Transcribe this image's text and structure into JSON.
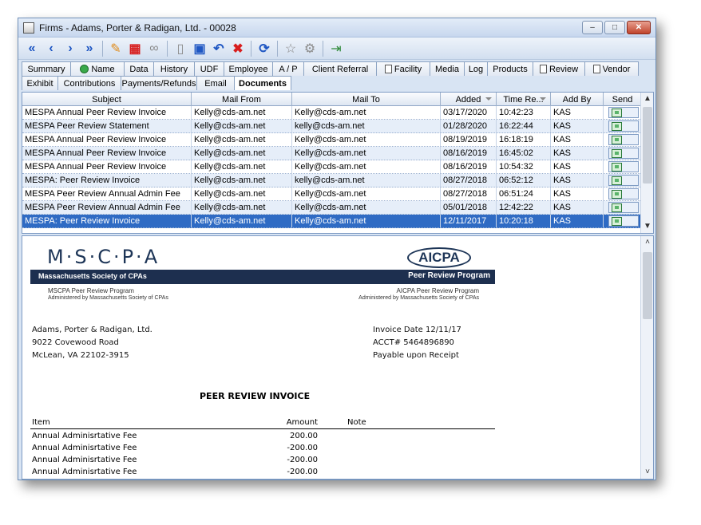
{
  "window": {
    "title": "Firms - Adams, Porter & Radigan, Ltd. - 00028"
  },
  "toolbar": {
    "buttons": [
      {
        "name": "first-record-icon",
        "glyph": "«"
      },
      {
        "name": "previous-record-icon",
        "glyph": "‹"
      },
      {
        "name": "next-record-icon",
        "glyph": "›"
      },
      {
        "name": "last-record-icon",
        "glyph": "»"
      },
      {
        "name": "notes-icon",
        "glyph": "✎"
      },
      {
        "name": "book-icon",
        "glyph": "▦"
      },
      {
        "name": "binoculars-icon",
        "glyph": "∞"
      },
      {
        "name": "new-document-icon",
        "glyph": "▯"
      },
      {
        "name": "save-icon",
        "glyph": "▣"
      },
      {
        "name": "undo-icon",
        "glyph": "↶"
      },
      {
        "name": "delete-icon",
        "glyph": "✖"
      },
      {
        "name": "refresh-icon",
        "glyph": "⟳"
      },
      {
        "name": "favorite-star-icon",
        "glyph": "☆"
      },
      {
        "name": "tools-icon",
        "glyph": "⚙"
      },
      {
        "name": "exit-icon",
        "glyph": "⇥"
      }
    ]
  },
  "tabs_row1": [
    {
      "label": "Summary",
      "icon": ""
    },
    {
      "label": "Name",
      "icon": "green"
    },
    {
      "label": "Data",
      "icon": ""
    },
    {
      "label": "History",
      "icon": ""
    },
    {
      "label": "UDF",
      "icon": ""
    },
    {
      "label": "Employee",
      "icon": ""
    },
    {
      "label": "A / P",
      "icon": ""
    },
    {
      "label": "Client Referral",
      "icon": ""
    },
    {
      "label": "Facility",
      "icon": "doc"
    },
    {
      "label": "Media",
      "icon": ""
    },
    {
      "label": "Log",
      "icon": ""
    },
    {
      "label": "Products",
      "icon": ""
    },
    {
      "label": "Review",
      "icon": "doc"
    },
    {
      "label": "Vendor",
      "icon": "doc"
    }
  ],
  "tabs_row2": [
    {
      "label": "Exhibit"
    },
    {
      "label": "Contributions"
    },
    {
      "label": "Payments/Refunds"
    },
    {
      "label": "Email"
    },
    {
      "label": "Documents"
    }
  ],
  "grid": {
    "columns": [
      "Subject",
      "Mail From",
      "Mail To",
      "Added",
      "Time Re...",
      "Add By",
      "Send"
    ],
    "rows": [
      {
        "subject": "MESPA Annual Peer Review Invoice",
        "from": "Kelly@cds-am.net",
        "to": "Kelly@cds-am.net",
        "added": "03/17/2020",
        "time": "10:42:23",
        "addby": "KAS"
      },
      {
        "subject": "MESPA Peer Review Statement",
        "from": "Kelly@cds-am.net",
        "to": "kelly@cds-am.net",
        "added": "01/28/2020",
        "time": "16:22:44",
        "addby": "KAS"
      },
      {
        "subject": "MESPA Annual Peer Review Invoice",
        "from": "Kelly@cds-am.net",
        "to": "Kelly@cds-am.net",
        "added": "08/19/2019",
        "time": "16:18:19",
        "addby": "KAS"
      },
      {
        "subject": "MESPA Annual Peer Review Invoice",
        "from": "Kelly@cds-am.net",
        "to": "Kelly@cds-am.net",
        "added": "08/16/2019",
        "time": "16:45:02",
        "addby": "KAS"
      },
      {
        "subject": "MESPA Annual Peer Review Invoice",
        "from": "Kelly@cds-am.net",
        "to": "Kelly@cds-am.net",
        "added": "08/16/2019",
        "time": "10:54:32",
        "addby": "KAS"
      },
      {
        "subject": "MESPA:  Peer Review Invoice",
        "from": "Kelly@cds-am.net",
        "to": "kelly@cds-am.net",
        "added": "08/27/2018",
        "time": "06:52:12",
        "addby": "KAS"
      },
      {
        "subject": "MESPA Peer Review Annual Admin Fee",
        "from": "Kelly@cds-am.net",
        "to": "Kelly@cds-am.net",
        "added": "08/27/2018",
        "time": "06:51:24",
        "addby": "KAS"
      },
      {
        "subject": "MESPA Peer Review Annual Admin Fee",
        "from": "Kelly@cds-am.net",
        "to": "Kelly@cds-am.net",
        "added": "05/01/2018",
        "time": "12:42:22",
        "addby": "KAS"
      },
      {
        "subject": "MESPA:  Peer Review Invoice",
        "from": "Kelly@cds-am.net",
        "to": "Kelly@cds-am.net",
        "added": "12/11/2017",
        "time": "10:20:18",
        "addby": "KAS",
        "selected": true
      }
    ]
  },
  "preview": {
    "mscpa_logo": "M·S·C·P·A",
    "aicpa_logo": "AICPA",
    "banner_left": "Massachusetts Society of CPAs",
    "banner_right": "Peer Review Program",
    "left_sub1": "MSCPA Peer Review Program",
    "left_sub2": "Administered by Massachusetts Society of CPAs",
    "right_sub1": "AICPA Peer Review Program",
    "right_sub2": "Administered by Massachusetts Society of CPAs",
    "address": [
      "Adams, Porter & Radigan, Ltd.",
      "9022 Covewood Road",
      "McLean, VA  22102-3915"
    ],
    "meta": [
      "Invoice Date  12/11/17",
      "ACCT#  5464896890",
      "Payable upon Receipt"
    ],
    "invoice_title": "PEER REVIEW INVOICE",
    "table_headers": {
      "item": "Item",
      "amount": "Amount",
      "note": "Note"
    },
    "items": [
      {
        "item": "Annual Adminisrtative Fee",
        "amount": "200.00"
      },
      {
        "item": "Annual Adminisrtative Fee",
        "amount": "-200.00"
      },
      {
        "item": "Annual Adminisrtative Fee",
        "amount": "-200.00"
      },
      {
        "item": "Annual Adminisrtative Fee",
        "amount": "-200.00"
      }
    ]
  }
}
